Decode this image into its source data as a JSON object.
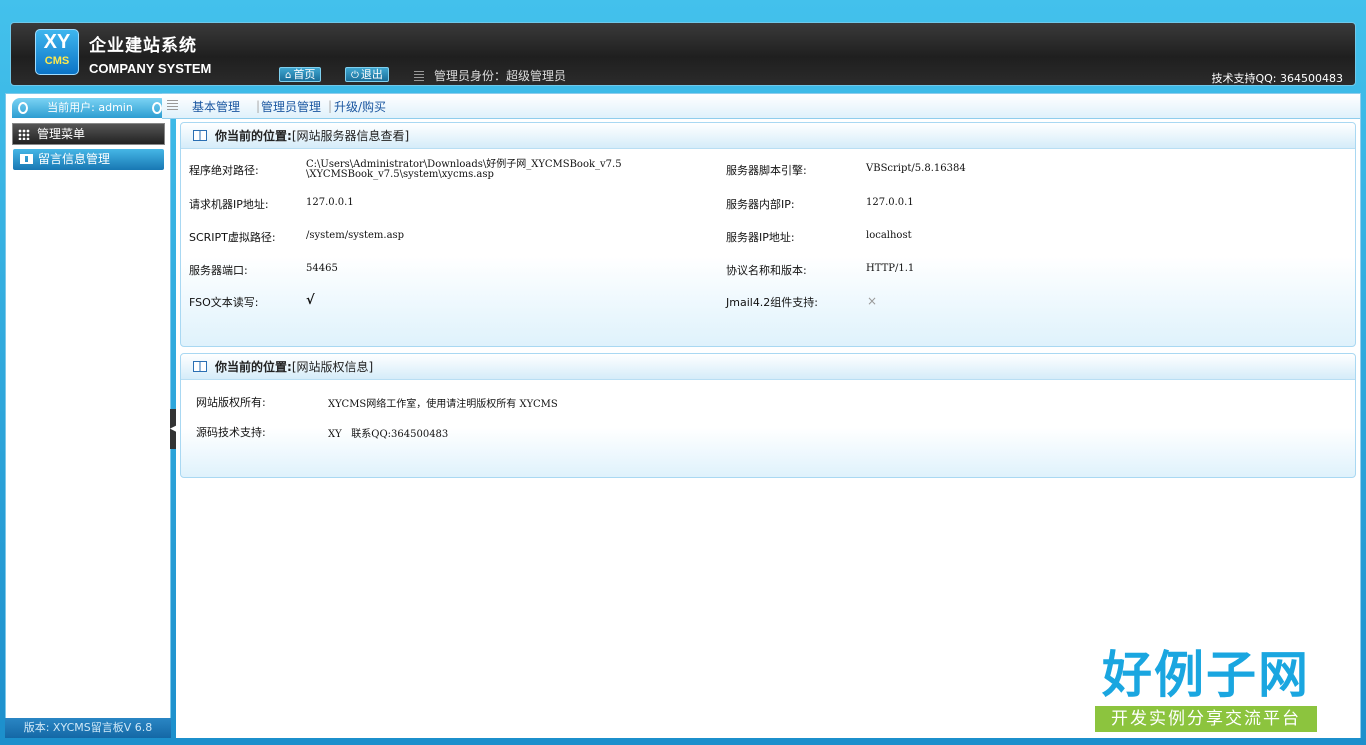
{
  "header": {
    "logo_top": "XY",
    "logo_bottom": "CMS",
    "title_cn": "企业建站系统",
    "title_en": "COMPANY SYSTEM",
    "home_label": "首页",
    "logout_label": "退出",
    "role_text": "管理员身份：超级管理员",
    "support_text": "技术支持QQ: 364500483"
  },
  "sidebar": {
    "current_user": "当前用户: admin",
    "menu_head": "管理菜单",
    "items": [
      {
        "label": "留言信息管理"
      }
    ],
    "version": "版本: XYCMS留言板V 6.8"
  },
  "topnav": {
    "items": [
      {
        "label": "基本管理"
      },
      {
        "label": "管理员管理"
      },
      {
        "label": "升级/购买"
      }
    ]
  },
  "server_panel": {
    "title_prefix": "你当前的位置:",
    "title_loc": "[网站服务器信息查看]",
    "rows": [
      {
        "label": "程序绝对路径:",
        "value": "C:\\Users\\Administrator\\Downloads\\好例子网_XYCMSBook_v7.5",
        "value2": "\\XYCMSBook_v7.5\\system\\xycms.asp",
        "rlabel": "服务器脚本引擎:",
        "rvalue": "VBScript/5.8.16384"
      },
      {
        "label": "请求机器IP地址:",
        "value": "127.0.0.1",
        "rlabel": "服务器内部IP:",
        "rvalue": "127.0.0.1"
      },
      {
        "label": "SCRIPT虚拟路径:",
        "value": "/system/system.asp",
        "rlabel": "服务器IP地址:",
        "rvalue": "localhost"
      },
      {
        "label": "服务器端口:",
        "value": "54465",
        "rlabel": "协议名称和版本:",
        "rvalue": "HTTP/1.1"
      },
      {
        "label": "FSO文本读写:",
        "value": "√",
        "rlabel": "Jmail4.2组件支持:",
        "rvalue": "×"
      }
    ]
  },
  "copyright_panel": {
    "title_prefix": "你当前的位置:",
    "title_loc": "[网站版权信息]",
    "rows": [
      {
        "label": "网站版权所有:",
        "value": "XYCMS网络工作室，使用请注明版权所有 XYCMS"
      },
      {
        "label": "源码技术支持:",
        "value": "XY   联系QQ:364500483"
      }
    ]
  },
  "watermark": {
    "big": "好例子网",
    "small": "开发实例分享交流平台"
  }
}
